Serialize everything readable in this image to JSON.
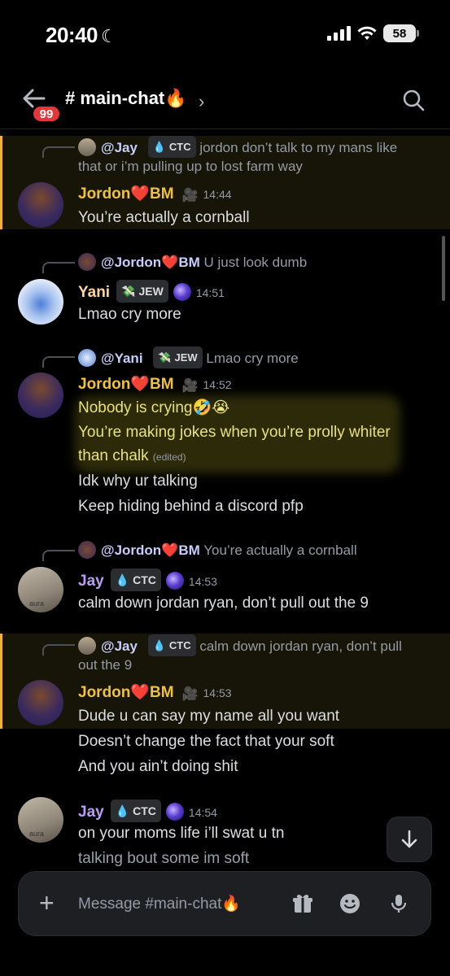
{
  "status": {
    "time": "20:40",
    "battery": "58"
  },
  "header": {
    "badge": "99",
    "channel": "# main-chat🔥"
  },
  "messages": {
    "m1": {
      "reply_user": "@Jay",
      "reply_tag": "CTC",
      "reply_text_1": "jordon don’t talk to my mans like",
      "reply_text_2": "that or i’m pulling up to lost farm way",
      "author": "Jordon❤️BM",
      "time": "14:44",
      "lines": [
        "You’re actually a cornball"
      ]
    },
    "m2": {
      "reply_user": "@Jordon❤️BM",
      "reply_text": "U just look dumb",
      "author": "Yani",
      "tag": "JEW",
      "time": "14:51",
      "lines": [
        "Lmao cry more"
      ]
    },
    "m3": {
      "reply_user": "@Yani",
      "reply_tag": "JEW",
      "reply_text": "Lmao cry more",
      "author": "Jordon❤️BM",
      "time": "14:52",
      "lines": [
        "Nobody is crying🤣😭",
        "You’re making jokes when you’re prolly whiter",
        "than chalk",
        "Idk why ur talking",
        "Keep hiding behind a discord pfp"
      ],
      "edited": "(edited)"
    },
    "m4": {
      "reply_user": "@Jordon❤️BM",
      "reply_text": "You’re actually a cornball",
      "author": "Jay",
      "tag": "CTC",
      "time": "14:53",
      "lines": [
        "calm down jordan ryan, don’t pull out the 9"
      ],
      "avatar_label": "aura"
    },
    "m5": {
      "reply_user": "@Jay",
      "reply_tag": "CTC",
      "reply_text_1": "calm down jordan ryan, don’t pull",
      "reply_text_2": "out the 9",
      "author": "Jordon❤️BM",
      "time": "14:53",
      "lines": [
        "Dude u can say my name all you want",
        "Doesn’t change the fact that your soft",
        "And you ain’t doing shit"
      ]
    },
    "m6": {
      "author": "Jay",
      "tag": "CTC",
      "time": "14:54",
      "lines": [
        "on your moms life i’ll swat u tn",
        "talking bout some im soft"
      ],
      "avatar_label": "aura"
    }
  },
  "composer": {
    "placeholder": "Message #main-chat🔥"
  },
  "colors": {
    "accent_highlight": "#f0b232",
    "jordon_name": "#f0c23a",
    "jay_name": "#b99cf5",
    "yani_name": "#ffd4a3",
    "badge_red": "#e5363b"
  },
  "icons": [
    "back-arrow-icon",
    "search-icon",
    "jump-down-icon",
    "plus-icon",
    "gift-icon",
    "emoji-icon",
    "microphone-icon",
    "droplet-icon",
    "money-icon",
    "camera-icon",
    "moon-icon",
    "wifi-icon",
    "signal-icon"
  ]
}
